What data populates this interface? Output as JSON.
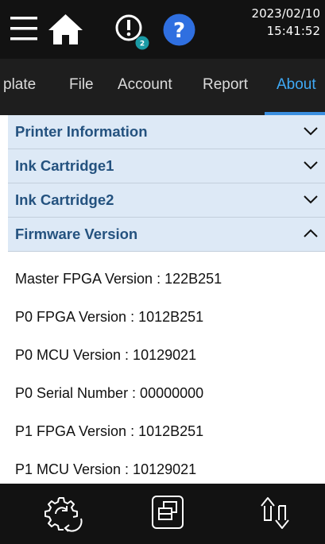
{
  "status_bar": {
    "date": "2023/02/10",
    "time": "15:41:52",
    "alert_badge_count": "2",
    "icons": [
      "menu-icon",
      "home-icon",
      "alert-icon",
      "help-icon"
    ],
    "colors": {
      "background": "#121212",
      "badge": "#1b9aa5",
      "help": "#2f6fe0"
    }
  },
  "tabs": {
    "items": [
      {
        "label": "plate"
      },
      {
        "label": "File"
      },
      {
        "label": "Account"
      },
      {
        "label": "Report"
      },
      {
        "label": "About"
      }
    ],
    "active": "About",
    "colors": {
      "active": "#3fa9f5",
      "inactive": "#dcdcdc"
    }
  },
  "accordion": {
    "sections": [
      {
        "title": "Printer Information",
        "expanded": false
      },
      {
        "title": "Ink Cartridge1",
        "expanded": false
      },
      {
        "title": "Ink Cartridge2",
        "expanded": false
      },
      {
        "title": "Firmware Version",
        "expanded": true
      }
    ],
    "firmware_items": [
      "Master FPGA Version : 122B251",
      "P0 FPGA Version : 1012B251",
      "P0 MCU Version : 10129021",
      "P0 Serial Number : 00000000",
      "P1 FPGA Version : 1012B251",
      "P1 MCU Version : 10129021"
    ],
    "colors": {
      "header_bg": "#dde9f6",
      "header_text": "#24527f"
    }
  },
  "bottom_bar": {
    "icons": [
      "settings-refresh-icon",
      "windows-icon",
      "transfer-icon"
    ]
  }
}
